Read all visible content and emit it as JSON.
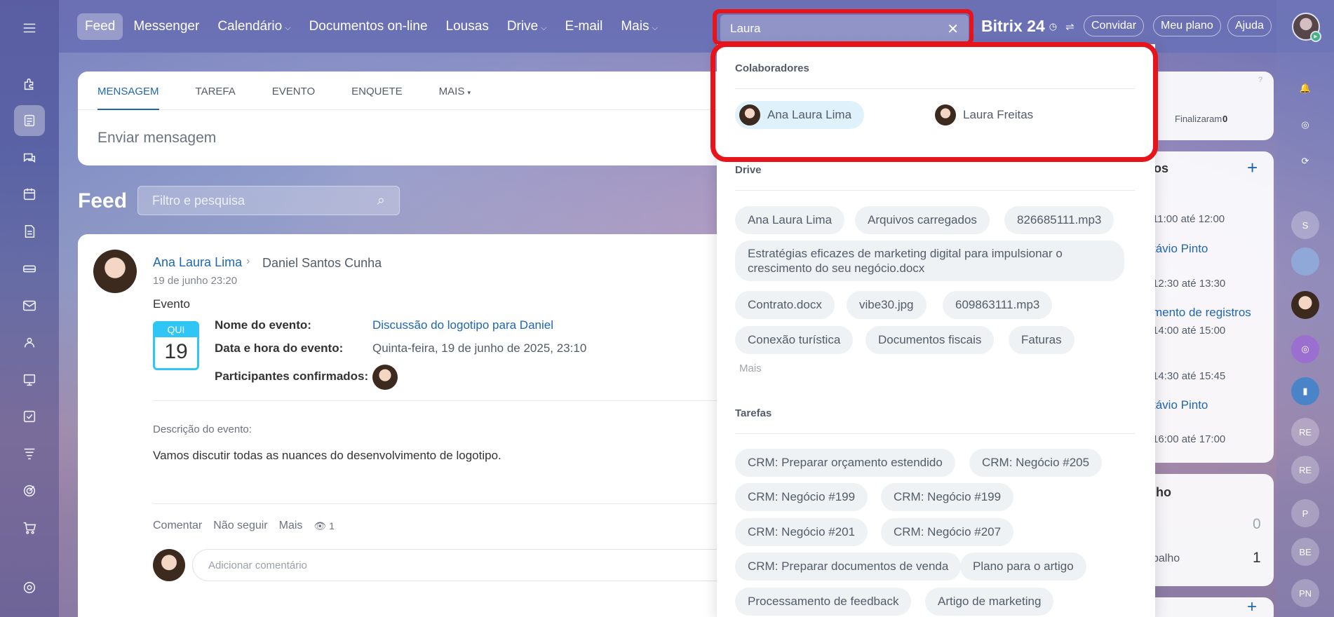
{
  "topnav": {
    "items": [
      "Feed",
      "Messenger",
      "Calendário",
      "Documentos on-line",
      "Lousas",
      "Drive",
      "E-mail",
      "Mais"
    ],
    "search_value": "Laura",
    "logo": "Bitrix 24",
    "invite": "Convidar",
    "plan": "Meu plano",
    "help": "Ajuda"
  },
  "composer": {
    "tabs": [
      "MENSAGEM",
      "TAREFA",
      "EVENTO",
      "ENQUETE",
      "MAIS"
    ],
    "placeholder": "Enviar mensagem"
  },
  "feed": {
    "title": "Feed",
    "filter_placeholder": "Filtro e pesquisa"
  },
  "post": {
    "author": "Ana Laura Lima",
    "recipient": "Daniel Santos Cunha",
    "date": "19 de junho 23:20",
    "type": "Evento",
    "cal_month": "QUI",
    "cal_day": "19",
    "event_name_label": "Nome do evento:",
    "event_name": "Discussão do logotipo para Daniel",
    "event_date_label": "Data e hora do evento:",
    "event_date": "Quinta-feira, 19 de junho de 2025, 23:10",
    "participants_label": "Participantes confirmados:",
    "desc_label": "Descrição do evento:",
    "desc": "Vamos discutir todas as nuances do desenvolvimento de logotipo.",
    "actions": [
      "Comentar",
      "Não seguir",
      "Mais"
    ],
    "views": "1",
    "comment_placeholder": "Adicionar comentário"
  },
  "right_widgets": {
    "finalized": "Finalizaram",
    "finalized_count": "0",
    "events_title_tail": "os",
    "slots": [
      "11:00 até 12:00",
      "12:30 até 13:30",
      "14:00 até 15:00",
      "14:30 até 15:45",
      "16:00 até 17:00"
    ],
    "links": [
      "távio Pinto",
      "mento de registros",
      "távio Pinto"
    ],
    "work_title_tail": "lho",
    "count_a": "0",
    "work_label_tail": "balho",
    "count_b": "1"
  },
  "right_strip": [
    "S",
    "RE",
    "RE",
    "P",
    "BE",
    "PN"
  ],
  "dropdown": {
    "collab_title": "Colaboradores",
    "collaborators": [
      "Ana Laura Lima",
      "Laura Freitas"
    ],
    "drive_title": "Drive",
    "drive_items": [
      "Ana Laura Lima",
      "Arquivos carregados",
      "826685111.mp3",
      "Estratégias eficazes de marketing digital para impulsionar o crescimento do seu negócio.docx",
      "Contrato.docx",
      "vibe30.jpg",
      "609863111.mp3",
      "Conexão turística",
      "Documentos fiscais",
      "Faturas"
    ],
    "more": "Mais",
    "tasks_title": "Tarefas",
    "tasks": [
      "CRM: Preparar orçamento estendido",
      "CRM: Negócio #205",
      "CRM: Negócio #199",
      "CRM: Negócio #199",
      "CRM: Negócio #201",
      "CRM: Negócio #207",
      "CRM: Preparar documentos de venda",
      "Plano para o artigo",
      "Processamento de feedback",
      "Artigo de marketing"
    ]
  },
  "colors": {
    "accent": "#2067b0",
    "highlight": "#e8141c",
    "cal": "#2fc6f6"
  }
}
